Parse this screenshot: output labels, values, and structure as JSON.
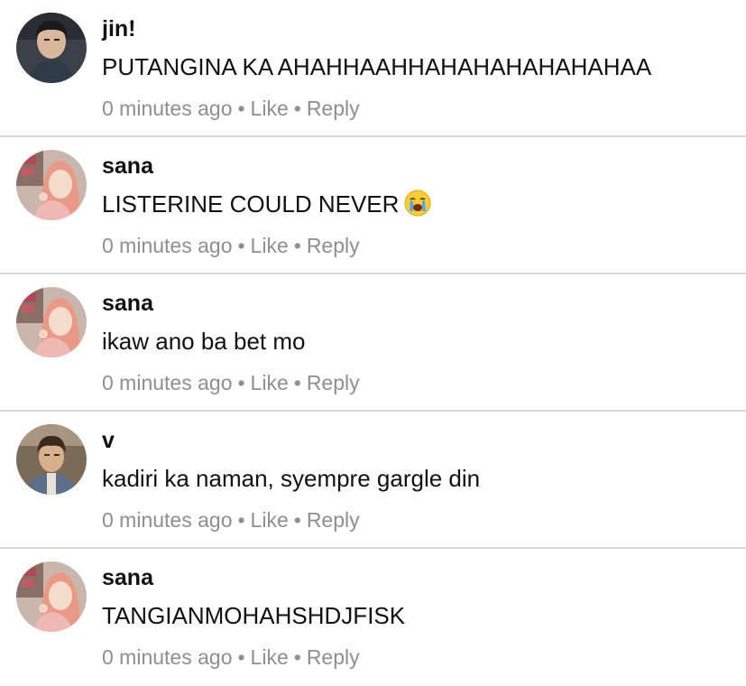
{
  "comments": [
    {
      "author": "jin!",
      "text": "PUTANGINA KA AHAHHAAHHAHAHAHAHAHAHAA",
      "time": "0 minutes ago",
      "like": "Like",
      "reply": "Reply",
      "separator": "•"
    },
    {
      "author": "sana",
      "text": "LISTERINE COULD NEVER",
      "emoji": "loudly-crying-face-icon",
      "time": "0 minutes ago",
      "like": "Like",
      "reply": "Reply",
      "separator": "•"
    },
    {
      "author": "sana",
      "text": "ikaw ano ba bet mo",
      "time": "0 minutes ago",
      "like": "Like",
      "reply": "Reply",
      "separator": "•"
    },
    {
      "author": "v",
      "text": "kadiri ka naman, syempre gargle din",
      "time": "0 minutes ago",
      "like": "Like",
      "reply": "Reply",
      "separator": "•"
    },
    {
      "author": "sana",
      "text": "TANGIANMOHAHSHDJFISK",
      "time": "0 minutes ago",
      "like": "Like",
      "reply": "Reply",
      "separator": "•"
    }
  ],
  "colors": {
    "text": "#111111",
    "meta": "#8e8e93",
    "divider": "#d8d8dc",
    "background": "#ffffff"
  }
}
